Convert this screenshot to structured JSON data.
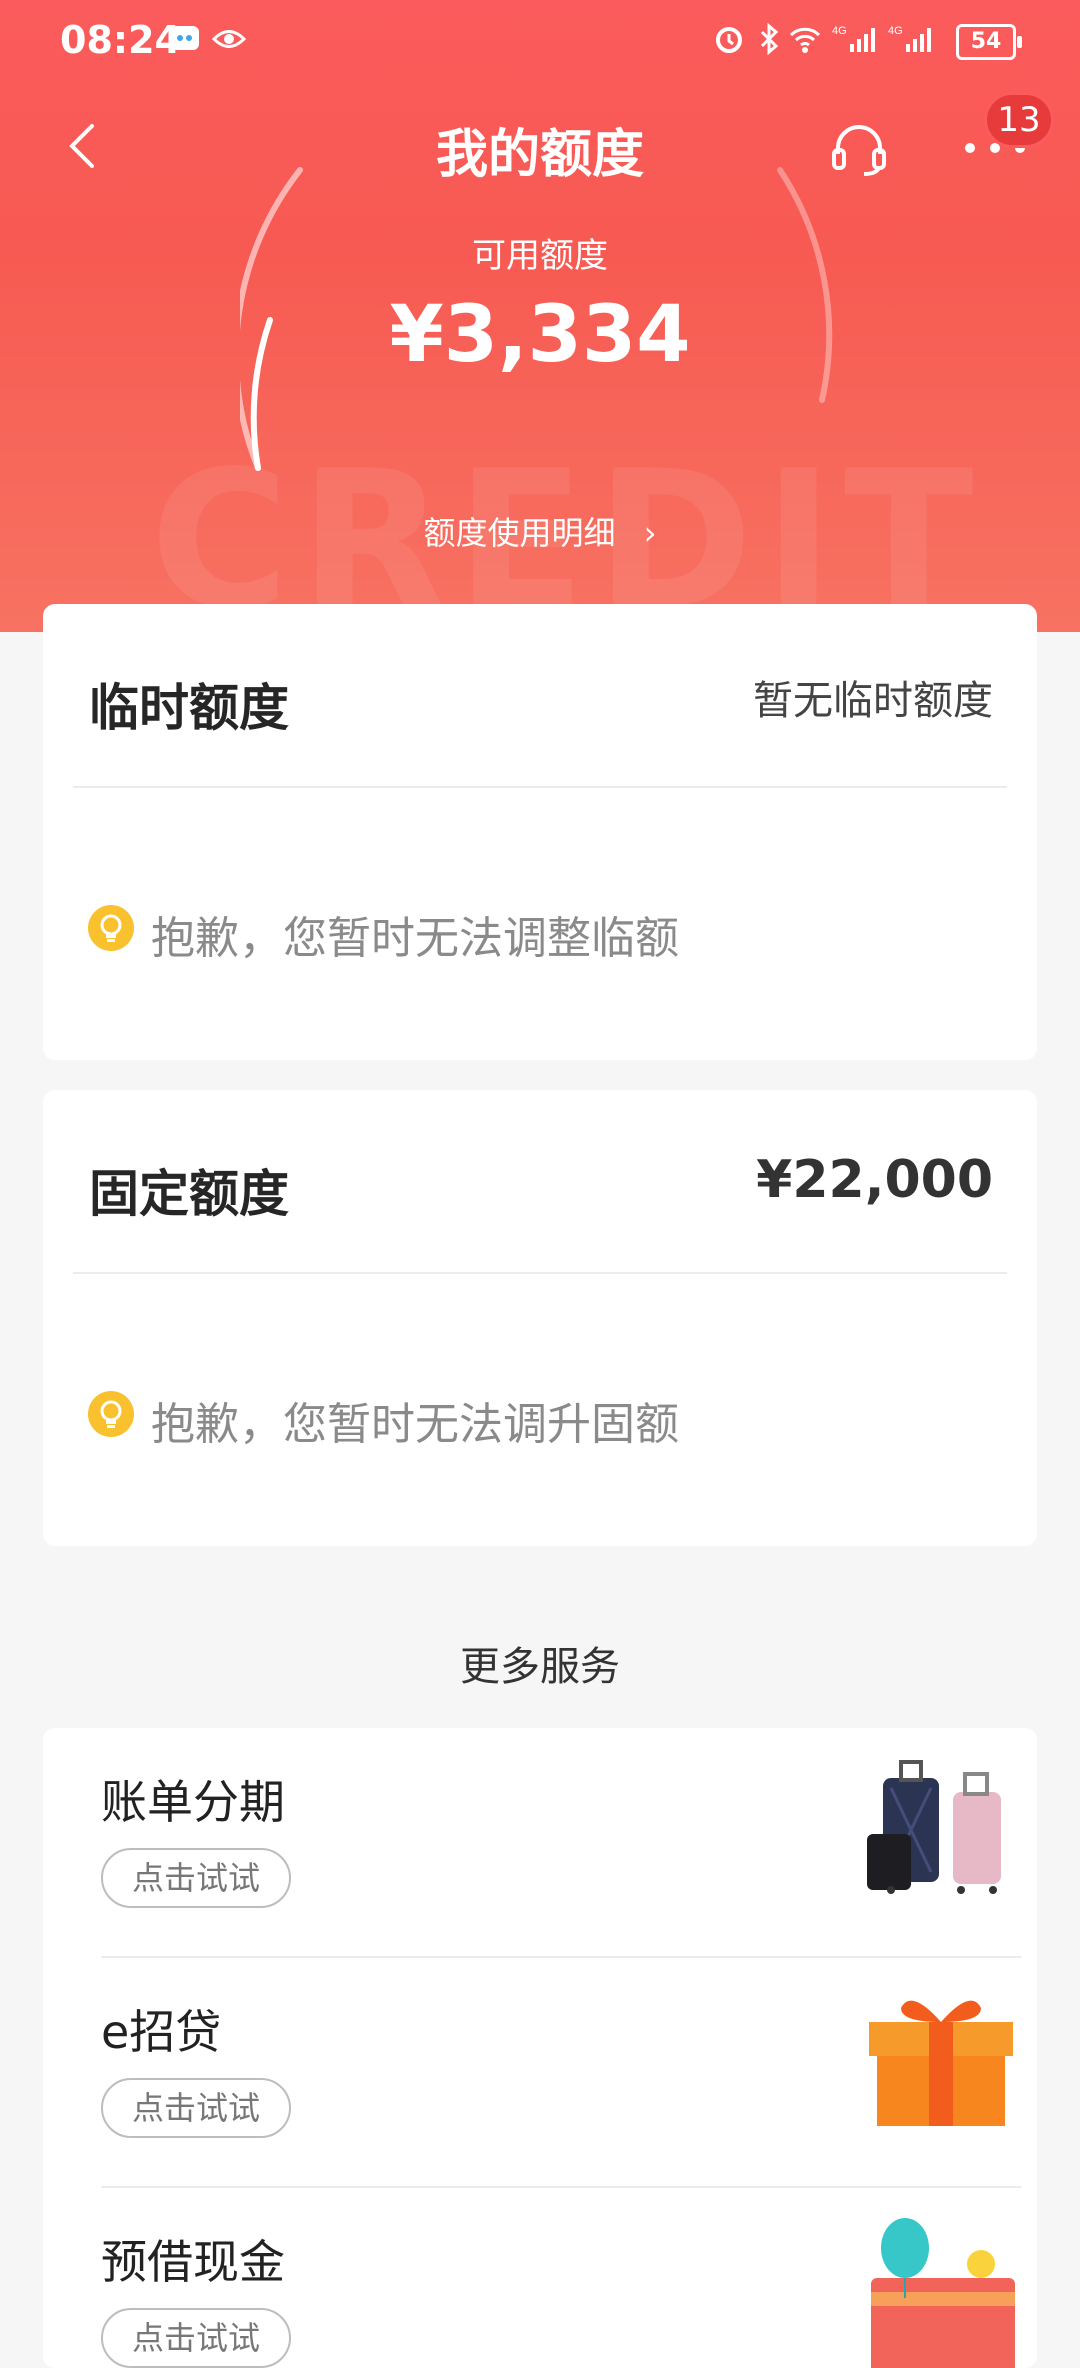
{
  "status_bar": {
    "time": "08:24",
    "battery": "54"
  },
  "header": {
    "title": "我的额度",
    "more_badge": "13"
  },
  "available": {
    "label": "可用额度",
    "amount": "¥3,334",
    "detail_link": "额度使用明细"
  },
  "temporary": {
    "title": "临时额度",
    "status": "暂无临时额度",
    "tip": "抱歉，您暂时无法调整临额"
  },
  "fixed": {
    "title": "固定额度",
    "amount": "¥22,000",
    "tip": "抱歉，您暂时无法调升固额"
  },
  "more_services": {
    "title": "更多服务",
    "items": [
      {
        "name": "账单分期",
        "button": "点击试试",
        "icon": "luggage-image"
      },
      {
        "name": "e招贷",
        "button": "点击试试",
        "icon": "gift-box-image"
      },
      {
        "name": "预借现金",
        "button": "点击试试",
        "icon": "cash-balloon-image"
      }
    ]
  },
  "colors": {
    "brand_red": "#fb5b5c",
    "tip_yellow": "#f9c12e"
  }
}
